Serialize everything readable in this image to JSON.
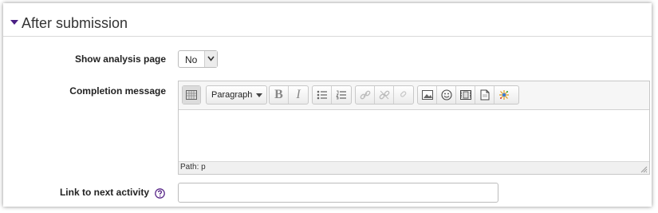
{
  "section": {
    "title": "After submission"
  },
  "fields": {
    "show_analysis": {
      "label": "Show analysis page",
      "value": "No"
    },
    "completion": {
      "label": "Completion message",
      "format_value": "Paragraph",
      "bold": "B",
      "italic": "I",
      "path_text": "Path: p"
    },
    "next_activity": {
      "label": "Link to next activity",
      "value": ""
    }
  },
  "colors": {
    "accent": "#4a1f84"
  },
  "icons": [
    "collapse-triangle-icon",
    "kitchen-sink-icon",
    "bold-icon",
    "italic-icon",
    "unordered-list-icon",
    "ordered-list-icon",
    "link-icon",
    "unlink-icon",
    "anchor-icon",
    "image-icon",
    "emoticon-icon",
    "media-icon",
    "paste-word-icon",
    "spellcheck-icon",
    "help-icon",
    "resize-grip-icon"
  ]
}
